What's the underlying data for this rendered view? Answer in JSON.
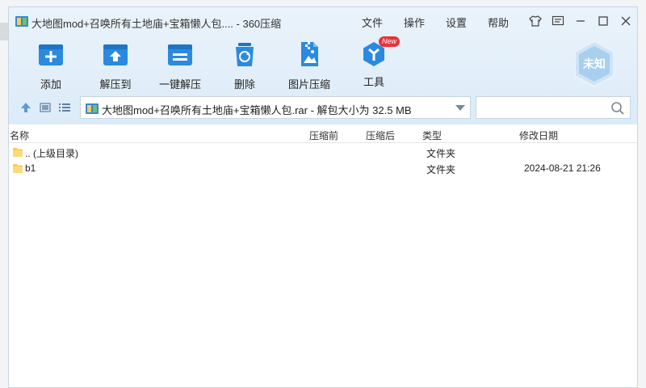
{
  "window": {
    "title": "大地图mod+召唤所有土地庙+宝箱懒人包.... - 360压缩"
  },
  "menu": [
    "文件",
    "操作",
    "设置",
    "帮助"
  ],
  "window_controls": [
    "skin-icon",
    "feedback-icon",
    "minimize-icon",
    "maximize-icon",
    "close-icon"
  ],
  "toolbar": {
    "items": [
      {
        "label": "添加",
        "icon": "add-icon"
      },
      {
        "label": "解压到",
        "icon": "extract-to-icon"
      },
      {
        "label": "一键解压",
        "icon": "one-click-extract-icon"
      },
      {
        "label": "删除",
        "icon": "delete-icon"
      },
      {
        "label": "图片压缩",
        "icon": "image-compress-icon"
      },
      {
        "label": "工具",
        "icon": "tools-icon",
        "badge": "New"
      }
    ]
  },
  "security_badge": "未知",
  "address": {
    "path": "大地图mod+召唤所有土地庙+宝箱懒人包.rar - 解包大小为 32.5 MB",
    "search_placeholder": ""
  },
  "columns": {
    "name": "名称",
    "original_size": "压缩前",
    "compressed_size": "压缩后",
    "type": "类型",
    "modified": "修改日期"
  },
  "files": [
    {
      "name": ".. (上级目录)",
      "type": "文件夹",
      "modified": ""
    },
    {
      "name": "b1",
      "type": "文件夹",
      "modified": "2024-08-21 21:26"
    }
  ],
  "colors": {
    "accent_blue": "#2a8ae0",
    "header_bg": "#dcebf8",
    "folder_yellow": "#f5cd5b",
    "new_badge": "#e3343a"
  }
}
